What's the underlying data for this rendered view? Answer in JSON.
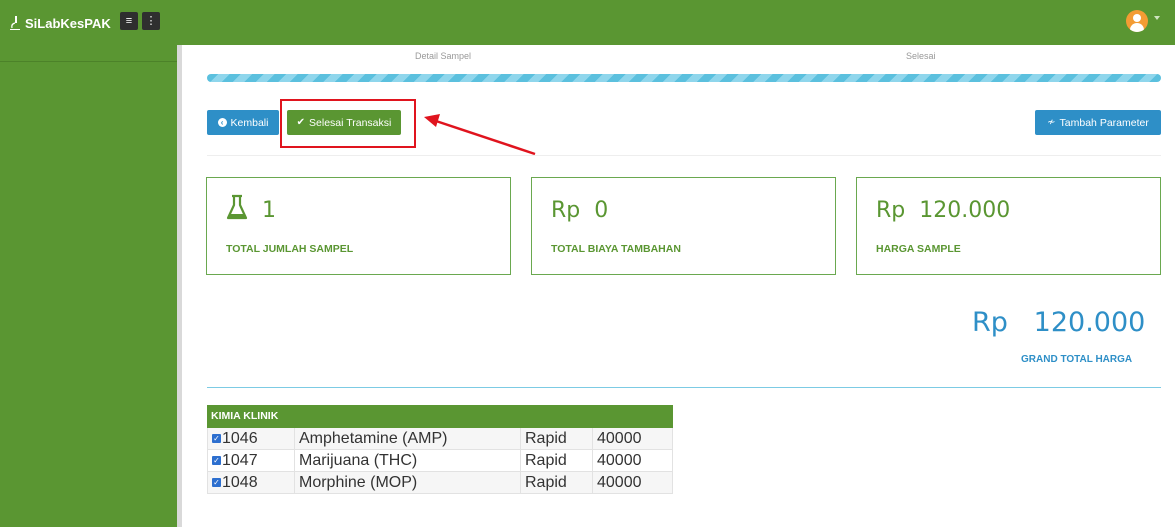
{
  "app": {
    "brand": "SiLabKesPAK"
  },
  "wizard": {
    "steps": [
      "Detail Sampel",
      "Selesai"
    ],
    "progress": 1.0
  },
  "actions": {
    "back": "Kembali",
    "finish": "Selesai Transaksi",
    "add_param": "Tambah Parameter"
  },
  "stats": [
    {
      "value": "1",
      "label": "TOTAL JUMLAH SAMPEL",
      "icon": "flask-icon"
    },
    {
      "value": "Rp  0",
      "label": "TOTAL BIAYA TAMBAHAN"
    },
    {
      "value": "Rp  120.000",
      "label": "HARGA SAMPLE"
    }
  ],
  "grand_total": {
    "currency": "Rp",
    "value": "120.000",
    "label": "GRAND TOTAL HARGA"
  },
  "table": {
    "title": "KIMIA KLINIK",
    "rows": [
      {
        "code": "1046",
        "name": "Amphetamine (AMP)",
        "method": "Rapid",
        "price": "40000",
        "checked": true
      },
      {
        "code": "1047",
        "name": "Marijuana (THC)",
        "method": "Rapid",
        "price": "40000",
        "checked": true
      },
      {
        "code": "1048",
        "name": "Morphine (MOP)",
        "method": "Rapid",
        "price": "40000",
        "checked": true
      }
    ]
  },
  "colors": {
    "brand_green": "#5a9632",
    "accent_blue": "#2e8fc7",
    "highlight_red": "#e0141e"
  }
}
